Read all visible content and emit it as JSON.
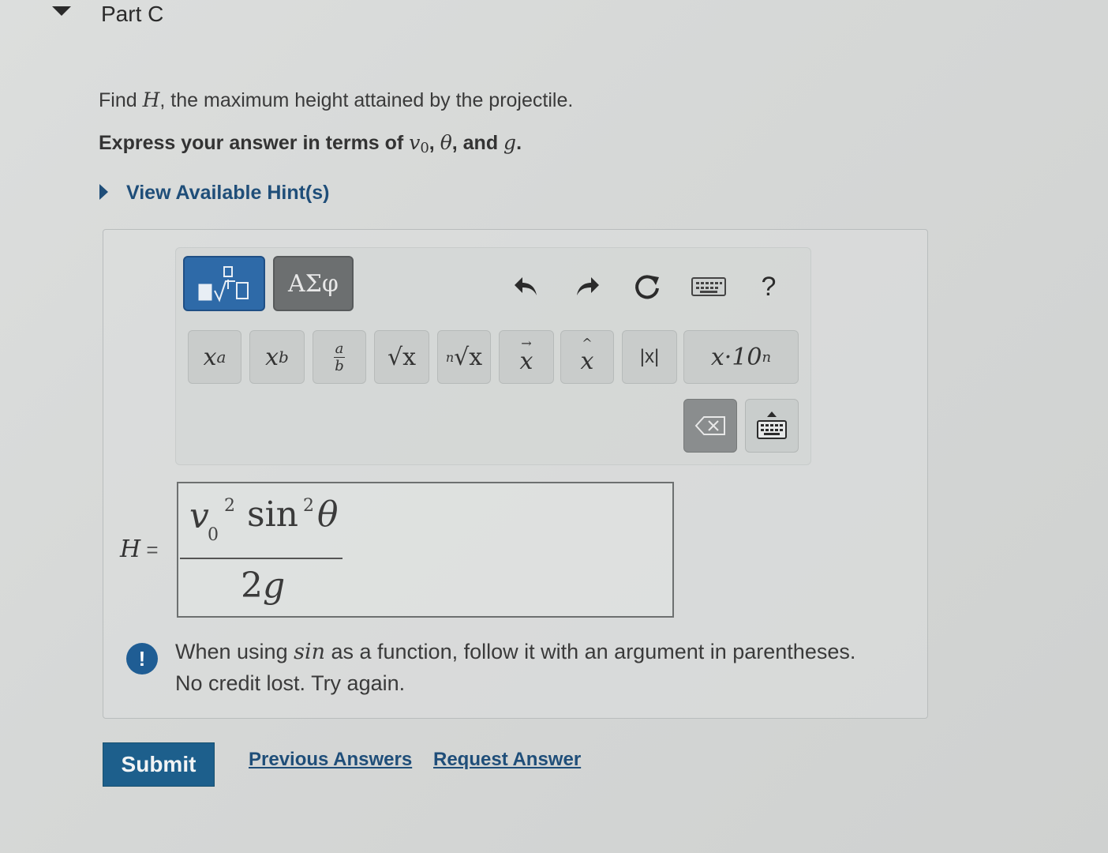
{
  "part": {
    "title": "Part C"
  },
  "question": {
    "find_prefix": "Find ",
    "find_var": "H",
    "find_suffix": ", the maximum height attained by the projectile.",
    "express_prefix": "Express your answer in terms of ",
    "var_v": "v",
    "var_v_sub": "0",
    "comma1": ", ",
    "var_theta": "θ",
    "comma2": ", and ",
    "var_g": "g",
    "express_suffix": "."
  },
  "hint": {
    "label": "View Available Hint(s)"
  },
  "toolbar": {
    "symbols_tab": "ΑΣφ",
    "help": "?",
    "keys": {
      "superscript_base": "x",
      "superscript_exp": "a",
      "subscript_base": "x",
      "subscript_sub": "b",
      "fraction_num": "a",
      "fraction_den": "b",
      "sqrt": "√x",
      "nroot_index": "n",
      "nroot": "√x",
      "vector": "x",
      "unit_vector": "x",
      "abs": "|x|",
      "sci_notation": "x·10",
      "sci_exp": "n"
    }
  },
  "answer": {
    "label_var": "H",
    "label_eq": " =",
    "num_v": "v",
    "num_sub": "0",
    "num_sup1": "2",
    "num_sin": "sin",
    "num_sup2": "2",
    "num_theta": "θ",
    "den_coef": "2",
    "den_var": "g"
  },
  "feedback": {
    "icon": "!",
    "line1_prefix": "When using ",
    "line1_fn": "sin",
    "line1_suffix": " as a function, follow it with an argument in parentheses.",
    "line2": "No credit lost. Try again."
  },
  "actions": {
    "submit": "Submit",
    "previous_answers": "Previous Answers",
    "request_answer": "Request Answer"
  },
  "colors": {
    "accent": "#1f4e79",
    "submit_bg": "#1d5f8c",
    "templates_tab": "#2e6aa8",
    "symbols_tab": "#6c6f70"
  }
}
